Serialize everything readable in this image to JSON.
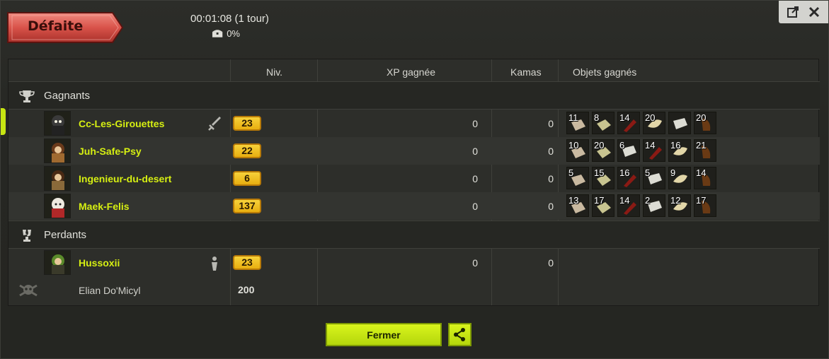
{
  "header": {
    "result": "Défaite",
    "duration": "00:01:08 (1 tour)",
    "chest_percent": "0%"
  },
  "columns": {
    "level": "Niv.",
    "xp": "XP gagnée",
    "kamas": "Kamas",
    "items": "Objets gagnés"
  },
  "winners": {
    "title": "Gagnants",
    "players": [
      {
        "name": "Cc-Les-Girouettes",
        "level": "23",
        "xp": "0",
        "kamas": "0",
        "role": "sword-icon",
        "items": [
          "11",
          "8",
          "14",
          "20",
          "",
          "20"
        ]
      },
      {
        "name": "Juh-Safe-Psy",
        "level": "22",
        "xp": "0",
        "kamas": "0",
        "items": [
          "10",
          "20",
          "6",
          "14",
          "16",
          "21"
        ]
      },
      {
        "name": "Ingenieur-du-desert",
        "level": "6",
        "xp": "0",
        "kamas": "0",
        "items": [
          "5",
          "15",
          "16",
          "5",
          "9",
          "14"
        ]
      },
      {
        "name": "Maek-Felis",
        "level": "137",
        "xp": "0",
        "kamas": "0",
        "items": [
          "13",
          "17",
          "14",
          "2",
          "12",
          "17"
        ]
      }
    ]
  },
  "losers": {
    "title": "Perdants",
    "players": [
      {
        "name": "Hussoxii",
        "level": "23",
        "xp": "0",
        "kamas": "0",
        "role": "person-icon"
      },
      {
        "name": "Elian Do'Micyl",
        "level": "200",
        "dead": true
      }
    ]
  },
  "buttons": {
    "close": "Fermer"
  },
  "colors": {
    "accent": "#c7e512",
    "player_name": "#d6ef12",
    "level_badge": "#f0c020",
    "defeat_ribbon": "#d9534a"
  }
}
